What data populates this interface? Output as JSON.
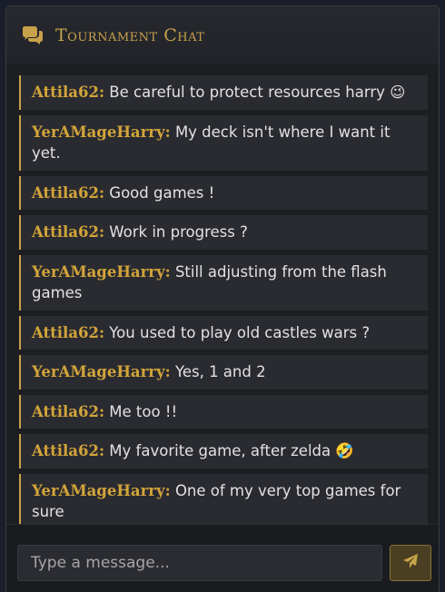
{
  "chat": {
    "title": "Tournament Chat",
    "input_placeholder": "Type a message...",
    "accent_color": "#c8a24a",
    "header_icon": "comments-icon",
    "send_icon": "paper-plane-icon"
  },
  "messages": [
    {
      "author": "Attila62:",
      "text": "Be careful to protect resources harry 😉"
    },
    {
      "author": "YerAMageHarry:",
      "text": "My deck isn't where I want it yet."
    },
    {
      "author": "Attila62:",
      "text": "Good games !"
    },
    {
      "author": "Attila62:",
      "text": "Work in progress ?"
    },
    {
      "author": "YerAMageHarry:",
      "text": "Still adjusting from the flash games"
    },
    {
      "author": "Attila62:",
      "text": "You used to play old castles wars ?"
    },
    {
      "author": "YerAMageHarry:",
      "text": "Yes, 1 and 2"
    },
    {
      "author": "Attila62:",
      "text": "Me too !!"
    },
    {
      "author": "Attila62:",
      "text": "My favorite game, after zelda 🤣"
    },
    {
      "author": "YerAMageHarry:",
      "text": "One of my very top games for sure"
    }
  ]
}
